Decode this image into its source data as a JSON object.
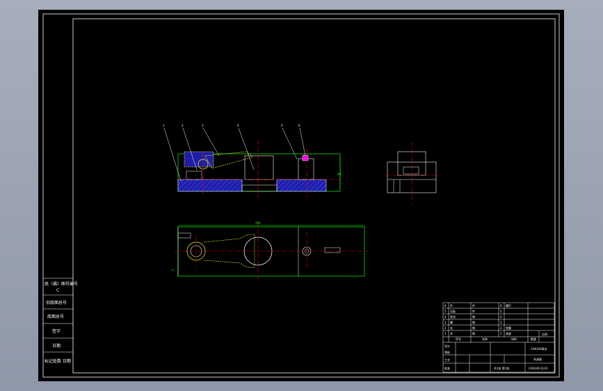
{
  "left_strip": {
    "row1": "底（描）图号编号",
    "row1b": "C",
    "row2": "旧底图总号",
    "row3": "底图总号",
    "row4": "签字",
    "row5": "日期",
    "row6": "标记处数  日期"
  },
  "callouts": [
    "1",
    "2",
    "3",
    "4",
    "5",
    "6"
  ],
  "dims": {
    "top_len": "200",
    "right_h": "40",
    "mark_a": "A"
  },
  "title_block": {
    "col_a": [
      "6",
      "5",
      "4",
      "3",
      "2",
      "1"
    ],
    "col_b": [
      "件",
      "压板",
      "垫块",
      "螺",
      "支",
      "夹"
    ],
    "col_c": [
      "件",
      "件",
      "钢",
      "钢",
      "钢",
      "钢"
    ],
    "col_d": [
      "6",
      "5",
      "4",
      "3",
      "2",
      "1"
    ],
    "col_e": [
      "螺钉",
      "",
      "",
      "",
      "垫圈",
      "底座"
    ],
    "hdr": [
      "序号",
      "名称",
      "材料",
      "数量"
    ],
    "part_name": "CA6140拨叉",
    "drawing_name": "夹具图",
    "scale": "比例",
    "sheet": "共1张  第1张",
    "number": "CA6140-CJ-01",
    "mid_labels": [
      "设计",
      "审核",
      "工艺",
      "批准"
    ]
  },
  "colors": {
    "frame": "#ffffff",
    "outline": "#00ff00",
    "center": "#ff0000",
    "hidden": "#ffff00",
    "hatch": "#2b2bff"
  }
}
